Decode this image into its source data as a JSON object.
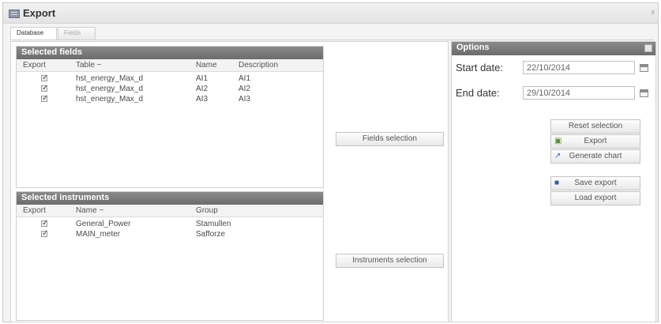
{
  "window": {
    "title": "Export",
    "close_glyph": "x"
  },
  "tabs": [
    {
      "label": "Database",
      "active": true
    },
    {
      "label": "Fields",
      "active": false
    }
  ],
  "fields_panel": {
    "title": "Selected fields",
    "columns": [
      "Export",
      "Table ~",
      "Name",
      "Description"
    ],
    "rows": [
      {
        "checked": true,
        "table": "hst_energy_Max_d",
        "name": "AI1",
        "description": "AI1"
      },
      {
        "checked": true,
        "table": "hst_energy_Max_d",
        "name": "AI2",
        "description": "AI2"
      },
      {
        "checked": true,
        "table": "hst_energy_Max_d",
        "name": "AI3",
        "description": "AI3"
      }
    ],
    "selection_button": "Fields selection"
  },
  "instruments_panel": {
    "title": "Selected instruments",
    "columns": [
      "Export",
      "Name ~",
      "Group"
    ],
    "rows": [
      {
        "checked": true,
        "name": "General_Power",
        "group": "Stamullen"
      },
      {
        "checked": true,
        "name": "MAIN_meter",
        "group": "Safforze"
      }
    ],
    "selection_button": "Instruments selection"
  },
  "options": {
    "title": "Options",
    "start_label": "Start date:",
    "start_value": "22/10/2014",
    "end_label": "End date:",
    "end_value": "29/10/2014",
    "buttons": {
      "reset": "Reset selection",
      "export": "Export",
      "generate_chart": "Generate chart",
      "save_export": "Save export",
      "load_export": "Load export"
    }
  },
  "icons": {
    "window": "window-icon",
    "calendar": "calendar-icon",
    "export": "export-icon",
    "chart": "chart-icon",
    "save": "save-icon",
    "check": "checkbox-icon"
  },
  "colors": {
    "panel_header": "#7a7a7a",
    "background": "#f4f4f4"
  }
}
